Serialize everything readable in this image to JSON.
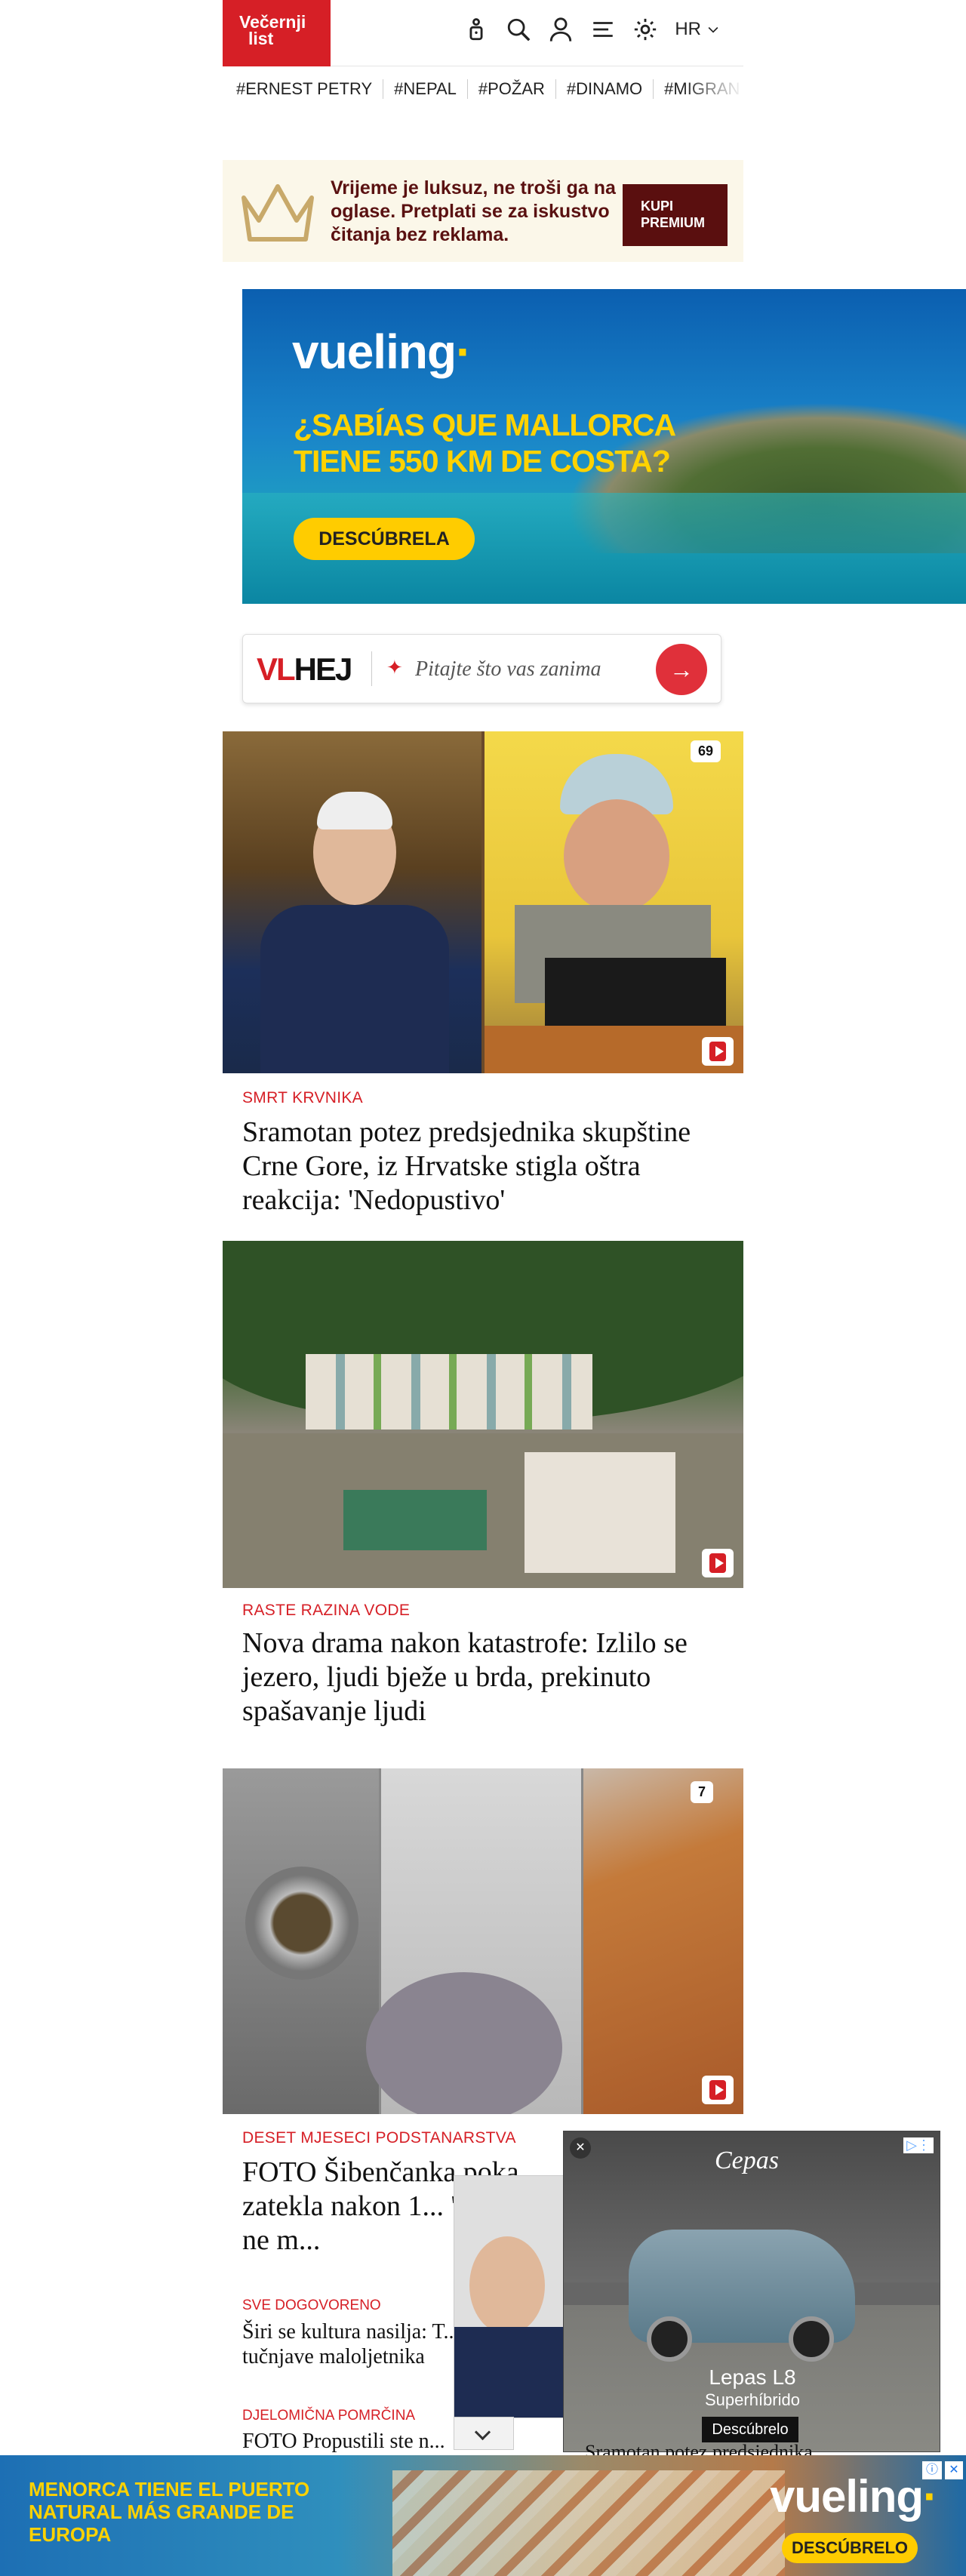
{
  "header": {
    "logo_line1": "Večernji",
    "logo_line2": "list",
    "lang": "HR"
  },
  "tags": [
    "#ERNEST PETRY",
    "#NEPAL",
    "#POŽAR",
    "#DINAMO",
    "#MIGRAN"
  ],
  "premium": {
    "text": "Vrijeme je luksuz, ne troši ga na oglase. Pretplati se za iskustvo čitanja bez reklama.",
    "button": "KUPI PREMIUM"
  },
  "ad_top": {
    "brand": "vueling",
    "headline_line1": "¿SABÍAS QUE MALLORCA",
    "headline_line2": "TIENE 550 KM DE COSTA?",
    "button": "DESCÚBRELA"
  },
  "vlhej": {
    "brand_red": "VL",
    "brand_black": "HEJ",
    "placeholder": "Pitajte što vas zanima"
  },
  "articles": [
    {
      "kicker": "SMRT KRVNIKA",
      "title": "Sramotan potez predsjednika skupštine Crne Gore, iz Hrvatske stigla oštra reakcija: 'Nedopustivo'",
      "photo_count": "69"
    },
    {
      "kicker": "RASTE RAZINA VODE",
      "title": "Nova drama nakon katastrofe: Izlilo se jezero, ljudi bježe u brda, prekinuto spašavanje ljudi"
    },
    {
      "kicker": "DESET MJESECI PODSTANARSTVA",
      "title": "FOTO Šibenčanka poka... zatekla nakon 1... 'Unutra se ne m...",
      "photo_count": "7"
    }
  ],
  "small_articles": [
    {
      "kicker": "SVE DOGOVORENO",
      "title": "Širi se kultura nasilja: T... tučnjave maloljetnika"
    },
    {
      "kicker": "DJELOMIČNA POMRČINA",
      "title": "FOTO Propustili ste n..."
    }
  ],
  "video_ad": {
    "brand": "Cepas",
    "model": "Lepas L8",
    "sub": "Superhíbrido",
    "cta": "Descúbrelo",
    "mini_caption": "Sramotan potez predsjednika"
  },
  "bottom_ad": {
    "text": "MENORCA TIENE EL PUERTO NATURAL MÁS GRANDE DE EUROPA",
    "brand": "vueling",
    "button": "DESCÚBRELO"
  }
}
